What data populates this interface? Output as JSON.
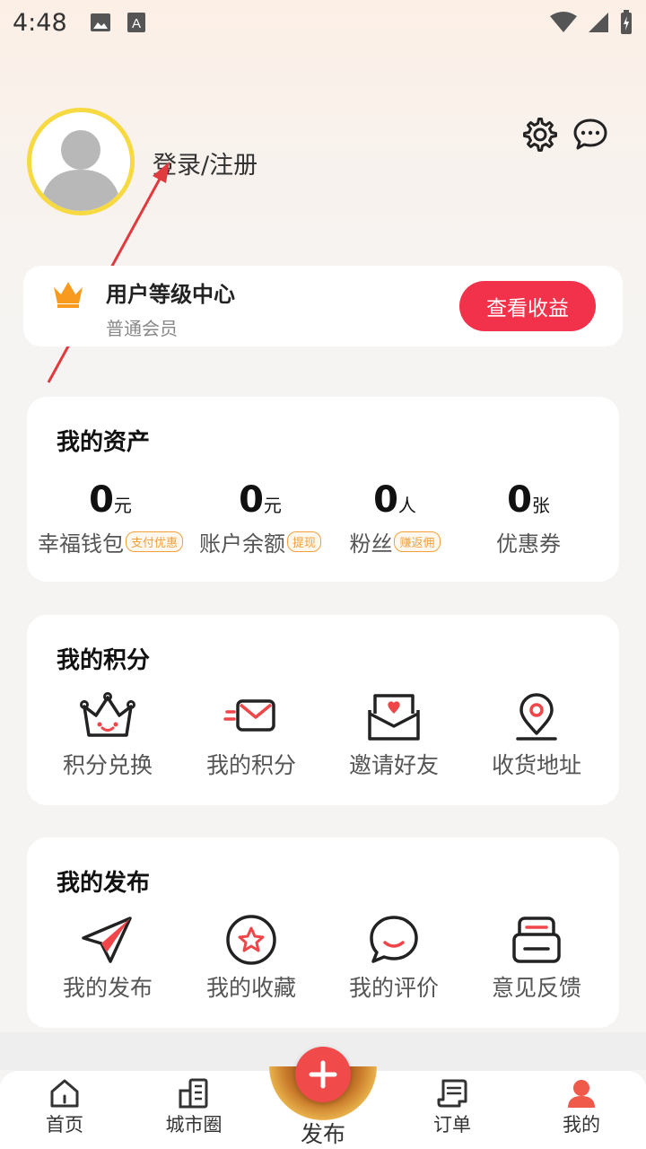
{
  "status_bar": {
    "time": "4:48"
  },
  "profile": {
    "login_label": "登录/注册"
  },
  "level": {
    "title": "用户等级中心",
    "subtitle": "普通会员",
    "button": "查看收益"
  },
  "assets": {
    "title": "我的资产",
    "items": [
      {
        "value": "0",
        "unit": "元",
        "label": "幸福钱包",
        "tag": "支付优惠"
      },
      {
        "value": "0",
        "unit": "元",
        "label": "账户余额",
        "tag": "提现"
      },
      {
        "value": "0",
        "unit": "人",
        "label": "粉丝",
        "tag": "赚返佣"
      },
      {
        "value": "0",
        "unit": "张",
        "label": "优惠券",
        "tag": ""
      }
    ]
  },
  "points": {
    "title": "我的积分",
    "items": [
      {
        "label": "积分兑换",
        "icon": "crown-face-icon"
      },
      {
        "label": "我的积分",
        "icon": "envelope-fast-icon"
      },
      {
        "label": "邀请好友",
        "icon": "heart-letter-icon"
      },
      {
        "label": "收货地址",
        "icon": "location-pin-icon"
      }
    ]
  },
  "publish": {
    "title": "我的发布",
    "items": [
      {
        "label": "我的发布",
        "icon": "paper-plane-icon"
      },
      {
        "label": "我的收藏",
        "icon": "star-circle-icon"
      },
      {
        "label": "我的评价",
        "icon": "chat-smile-icon"
      },
      {
        "label": "意见反馈",
        "icon": "feedback-box-icon"
      }
    ]
  },
  "nav": {
    "items": [
      {
        "label": "首页"
      },
      {
        "label": "城市圈"
      },
      {
        "label": "发布"
      },
      {
        "label": "订单"
      },
      {
        "label": "我的"
      }
    ]
  },
  "colors": {
    "accent": "#f1324a",
    "tag": "#f3a03b",
    "avatar_border": "#f7d942"
  }
}
